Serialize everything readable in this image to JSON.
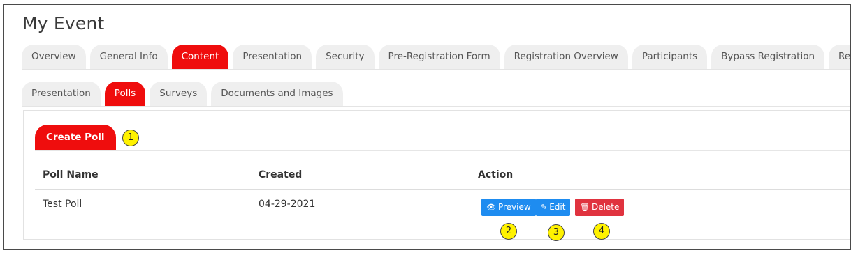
{
  "page": {
    "title": "My Event"
  },
  "main_tabs": [
    {
      "label": "Overview"
    },
    {
      "label": "General Info"
    },
    {
      "label": "Content",
      "active": true
    },
    {
      "label": "Presentation"
    },
    {
      "label": "Security"
    },
    {
      "label": "Pre-Registration Form"
    },
    {
      "label": "Registration Overview"
    },
    {
      "label": "Participants"
    },
    {
      "label": "Bypass Registration"
    },
    {
      "label": "Reports"
    }
  ],
  "sub_tabs": [
    {
      "label": "Presentation"
    },
    {
      "label": "Polls",
      "active": true
    },
    {
      "label": "Surveys"
    },
    {
      "label": "Documents and Images"
    }
  ],
  "create_button": {
    "label": "Create Poll"
  },
  "table": {
    "headers": {
      "name": "Poll Name",
      "created": "Created",
      "action": "Action"
    },
    "rows": [
      {
        "name": "Test Poll",
        "created": "04-29-2021"
      }
    ]
  },
  "actions": {
    "preview": "Preview",
    "edit": "Edit",
    "delete": "Delete"
  },
  "callouts": [
    "1",
    "2",
    "3",
    "4"
  ],
  "colors": {
    "accent": "#ef0d0d",
    "primary_button": "#1e8cf0",
    "danger_button": "#e0333f",
    "callout": "#fff200"
  },
  "icons": {
    "preview": "eye-icon",
    "edit": "edit-icon",
    "delete": "trash-icon"
  }
}
